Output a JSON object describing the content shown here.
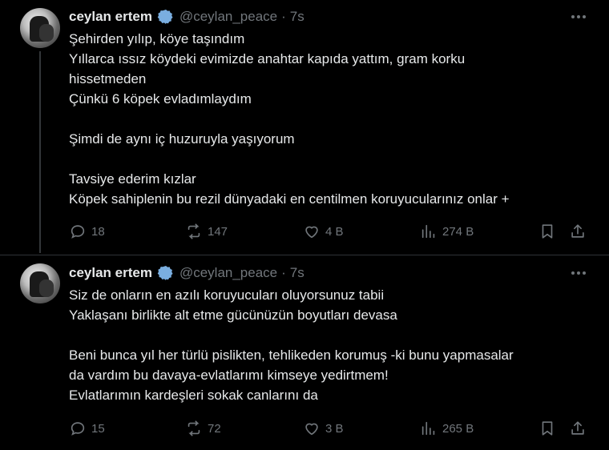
{
  "tweets": [
    {
      "author": {
        "name": "ceylan ertem",
        "handle": "@ceylan_peace",
        "separator": "·",
        "time": "7s"
      },
      "lines": [
        "Şehirden yılıp, köye taşındım",
        "Yıllarca ıssız köydeki evimizde anahtar kapıda yattım, gram korku",
        "hissetmeden",
        "Çünkü 6 köpek evladımlaydım",
        "",
        "Şimdi de aynı iç huzuruyla yaşıyorum",
        "",
        "Tavsiye ederim kızlar",
        "Köpek sahiplenin bu rezil dünyadaki en centilmen koruyucularınız onlar +"
      ],
      "stats": {
        "replies": "18",
        "reposts": "147",
        "likes": "4 B",
        "views": "274 B"
      }
    },
    {
      "author": {
        "name": "ceylan ertem",
        "handle": "@ceylan_peace",
        "separator": "·",
        "time": "7s"
      },
      "lines": [
        "Siz de onların en azılı koruyucuları oluyorsunuz tabii",
        "Yaklaşanı birlikte alt etme gücünüzün boyutları devasa",
        "",
        "Beni bunca yıl her türlü pislikten, tehlikeden korumuş -ki bunu yapmasalar",
        "da vardım bu davaya-evlatlarımı kimseye yedirtmem!",
        "Evlatlarımın kardeşleri sokak canlarını da"
      ],
      "stats": {
        "replies": "15",
        "reposts": "72",
        "likes": "3 B",
        "views": "265 B"
      }
    }
  ],
  "icons": {
    "verified_color": "#7aaee0",
    "action_color": "#71767b"
  }
}
